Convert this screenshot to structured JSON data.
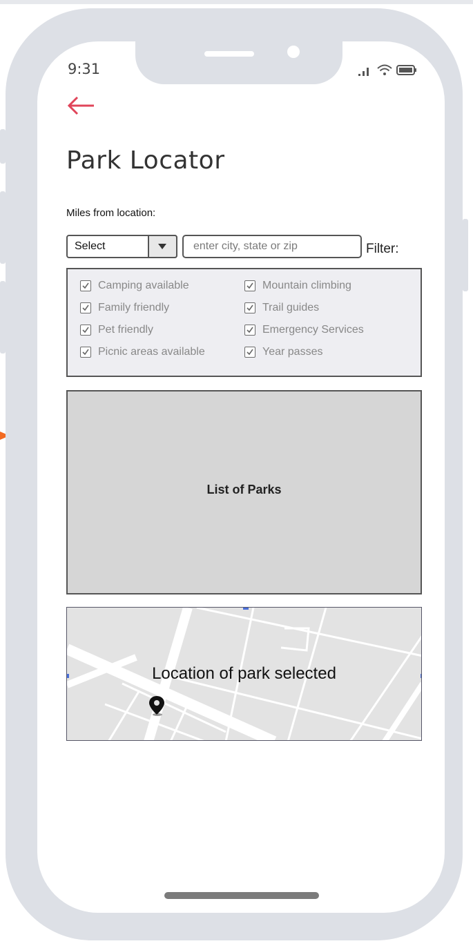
{
  "status_bar": {
    "time": "9:31"
  },
  "header": {
    "title": "Park Locator"
  },
  "search": {
    "miles_label": "Miles from location:",
    "select_value": "Select",
    "location_placeholder": "enter city, state or zip",
    "filter_label": "Filter:"
  },
  "filters": {
    "left": [
      {
        "label": "Camping available",
        "checked": true
      },
      {
        "label": "Family friendly",
        "checked": true
      },
      {
        "label": "Pet friendly",
        "checked": true
      },
      {
        "label": "Picnic areas available",
        "checked": true
      }
    ],
    "right": [
      {
        "label": "Mountain climbing",
        "checked": true
      },
      {
        "label": "Trail guides",
        "checked": true
      },
      {
        "label": "Emergency Services",
        "checked": true
      },
      {
        "label": "Year passes",
        "checked": true
      }
    ]
  },
  "list": {
    "label": "List of Parks"
  },
  "map": {
    "label": "Location of park selected",
    "pin_icon": "map-pin-icon"
  },
  "colors": {
    "accent": "#e0455a",
    "frame": "#dde0e6",
    "list_bg": "#d6d6d6",
    "map_bg": "#e3e3e3",
    "filter_bg": "#eeeef2"
  }
}
